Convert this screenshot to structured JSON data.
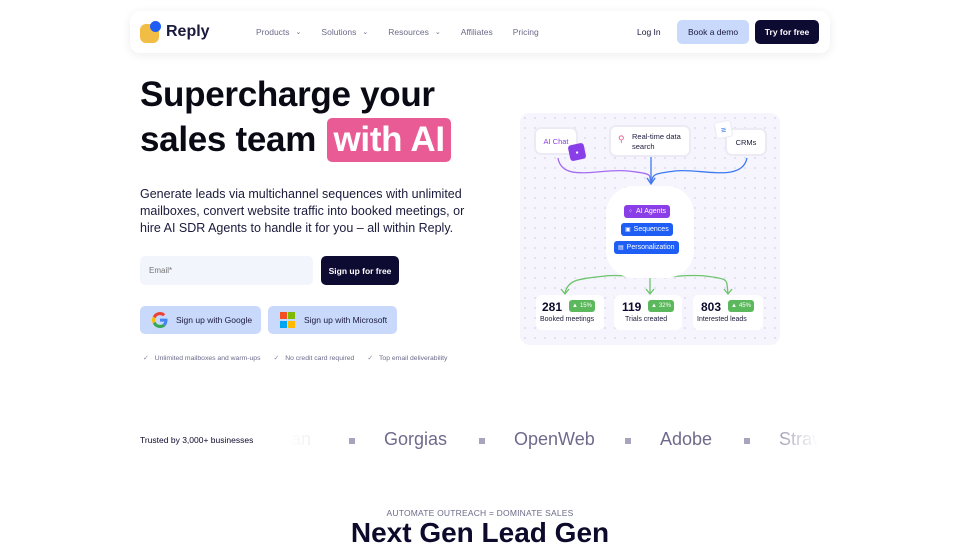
{
  "nav": {
    "brand": "Reply",
    "menu": [
      {
        "label": "Products",
        "has_dropdown": true
      },
      {
        "label": "Solutions",
        "has_dropdown": true
      },
      {
        "label": "Resources",
        "has_dropdown": true
      },
      {
        "label": "Affiliates",
        "has_dropdown": false
      },
      {
        "label": "Pricing",
        "has_dropdown": false
      }
    ],
    "login": "Log In",
    "book_demo": "Book a demo",
    "try_free": "Try for free",
    "chevron_glyph": "⌄"
  },
  "hero": {
    "title_line1": "Supercharge your",
    "title_line2": "sales team",
    "title_highlight": "with AI",
    "subtitle": "Generate leads via multichannel sequences with unlimited mailboxes, convert website traffic into booked meetings, or hire AI SDR Agents to handle it for you – all within Reply.",
    "email_placeholder": "Email*",
    "signup_button": "Sign up for free",
    "google_button": "Sign up with Google",
    "microsoft_button": "Sign up with Microsoft",
    "checks": [
      "Unlimited mailboxes and warm-ups",
      "No credit card required",
      "Top email deliverability"
    ],
    "check_glyph": "✓"
  },
  "diagram": {
    "sources": {
      "ai_chat": "AI Chat",
      "data_search": "Real-time data search",
      "crms": "CRMs"
    },
    "hub_pills": [
      {
        "label": "AI Agents",
        "icon": "sparkle-icon",
        "glyph": "⁘",
        "color": "#8a3ee8"
      },
      {
        "label": "Sequences",
        "icon": "lock-icon",
        "glyph": "▣",
        "color": "#1f5ef5"
      },
      {
        "label": "Personalization",
        "icon": "person-badge-icon",
        "glyph": "▤",
        "color": "#1f5ef5"
      }
    ],
    "stats": [
      {
        "value": "281",
        "change": "15%",
        "label": "Booked meetings"
      },
      {
        "value": "119",
        "change": "32%",
        "label": "Trials created"
      },
      {
        "value": "803",
        "change": "45%",
        "label": "Interested leads"
      }
    ],
    "arrow_glyph": "🡅",
    "colors": {
      "purple": "#a46cf0",
      "blue": "#3b7bf0",
      "green": "#6cc46c",
      "badge_green": "#5cb85c"
    }
  },
  "trusted": {
    "label": "Trusted by 3,000+ businesses",
    "logos": [
      "can",
      "Gorgias",
      "OpenWeb",
      "Adobe",
      "Strav"
    ]
  },
  "next_section": {
    "eyebrow": "AUTOMATE OUTREACH = DOMINATE SALES",
    "title": "Next Gen Lead Gen"
  },
  "colors": {
    "accent_pink": "#e95b95",
    "navy": "#0e0b33",
    "light_blue": "#c9d9fb",
    "brand_yellow": "#f2bd45",
    "brand_blue": "#1f5ef5"
  }
}
